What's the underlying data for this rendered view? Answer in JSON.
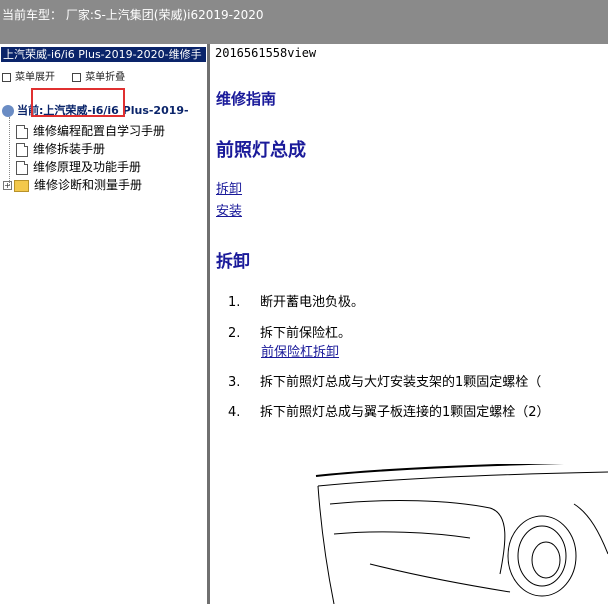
{
  "window": {
    "title": "当前车型： 厂家:S-上汽集团(荣威)i62019-2020"
  },
  "sidebar": {
    "header": "上汽荣威-i6/i6 Plus-2019-2020-维修手",
    "tools": {
      "expand": "菜单展开",
      "collapse": "菜单折叠"
    },
    "root": "当前:上汽荣威-i6/i6 Plus-2019-",
    "items": [
      {
        "label": "维修编程配置自学习手册"
      },
      {
        "label": "维修拆装手册"
      },
      {
        "label": "维修原理及功能手册"
      },
      {
        "label": "维修诊断和测量手册"
      }
    ]
  },
  "content": {
    "doc_id": "2016561558view",
    "guide_title": "维修指南",
    "section_title": "前照灯总成",
    "links": [
      "拆卸",
      "安装"
    ],
    "subsection": "拆卸",
    "steps": [
      {
        "num": "1.",
        "text": "断开蓄电池负极。"
      },
      {
        "num": "2.",
        "text": "拆下前保险杠。",
        "link": "前保险杠拆卸"
      },
      {
        "num": "3.",
        "text": "拆下前照灯总成与大灯安装支架的1颗固定螺栓（"
      },
      {
        "num": "4.",
        "text": "拆下前照灯总成与翼子板连接的1颗固定螺栓（2）"
      }
    ]
  }
}
